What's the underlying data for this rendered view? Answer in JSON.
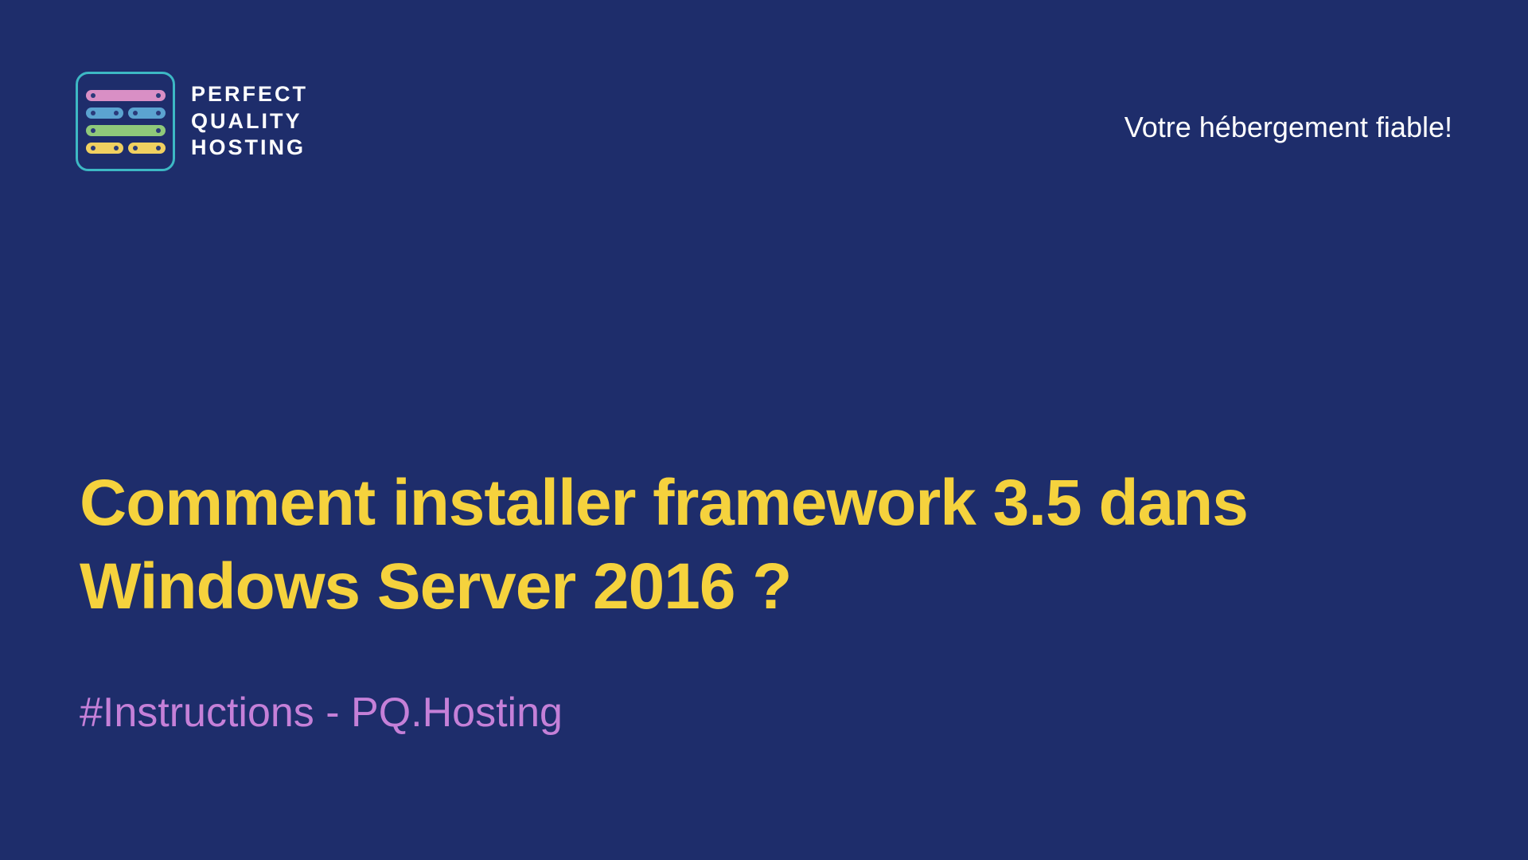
{
  "logo": {
    "line1": "PERFECT",
    "line2": "QUALITY",
    "line3": "HOSTING"
  },
  "tagline": "Votre hébergement fiable!",
  "title": "Comment installer framework 3.5 dans Windows Server 2016 ?",
  "subtitle": "#Instructions - PQ.Hosting",
  "colors": {
    "background": "#1e2d6b",
    "titleColor": "#f5d23d",
    "subtitleColor": "#c580d8",
    "logoAccent": "#3db8c4"
  }
}
